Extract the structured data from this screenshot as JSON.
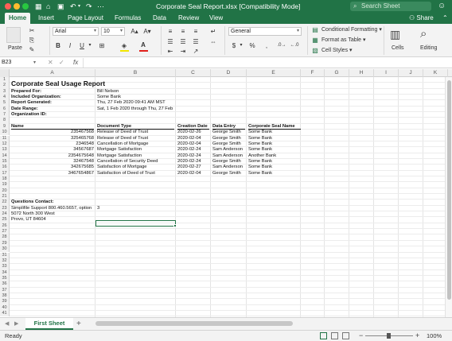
{
  "window": {
    "title": "Corporate Seal Report.xlsx  [Compatibility Mode]",
    "search_placeholder": "Search Sheet",
    "toolbar_icons": [
      "grid-icon",
      "home-icon",
      "save-icon",
      "undo-icon",
      "redo-icon",
      "more-icon"
    ]
  },
  "tabs": [
    "Home",
    "Insert",
    "Page Layout",
    "Formulas",
    "Data",
    "Review",
    "View"
  ],
  "active_tab": "Home",
  "share_label": "Share",
  "ribbon": {
    "paste_label": "Paste",
    "font_name": "Arial",
    "font_size": "10",
    "number_format": "General",
    "bold": "B",
    "italic": "I",
    "underline": "U",
    "grow_font": "A▴",
    "shrink_font": "A▾",
    "currency": "$",
    "percent": "%",
    "comma": ",",
    "conditional_formatting": "Conditional Formatting",
    "format_as_table": "Format as Table",
    "cell_styles": "Cell Styles",
    "cells_label": "Cells",
    "editing_label": "Editing"
  },
  "formula_bar": {
    "name_box": "B23",
    "fx": "fx",
    "cancel": "✕",
    "enter": "✓",
    "content": ""
  },
  "columns": [
    "A",
    "B",
    "C",
    "D",
    "E",
    "F",
    "G",
    "H",
    "I",
    "J",
    "K"
  ],
  "rows": [
    "1",
    "2",
    "3",
    "4",
    "5",
    "6",
    "7",
    "8",
    "9",
    "10",
    "11",
    "12",
    "13",
    "14",
    "15",
    "16",
    "17",
    "18",
    "19",
    "20",
    "21",
    "22",
    "23",
    "24",
    "25",
    "26",
    "27",
    "28",
    "29",
    "30",
    "31",
    "32",
    "33",
    "34",
    "35",
    "36",
    "37",
    "38",
    "39",
    "40",
    "41"
  ],
  "report": {
    "title": "Corporate Seal Usage Report",
    "info": [
      {
        "label": "Prepared For:",
        "value": "Bill Nelson"
      },
      {
        "label": "Included Organization:",
        "value": "Some Bank"
      },
      {
        "label": "Report Generated:",
        "value": "Thu, 27 Feb 2020 09:41 AM MST"
      },
      {
        "label": "Date Range:",
        "value": "Sat, 1 Feb 2020 through Thu, 27 Feb"
      },
      {
        "label": "Organization ID:",
        "value": ""
      }
    ],
    "table_headers": [
      "Name",
      "Document Type",
      "Creation Date",
      "Data Entry",
      "Corporate Seal Name"
    ],
    "table_rows": [
      [
        "235467568",
        "Release of Deed of Trust",
        "2020-02-26",
        "George Smith",
        "Some Bank"
      ],
      [
        "325465768",
        "Release of Deed of Trust",
        "2020-02-04",
        "George Smith",
        "Some Bank"
      ],
      [
        "2346548",
        "Cancellation of Mortgage",
        "2020-02-04",
        "George Smith",
        "Some Bank"
      ],
      [
        "34567687",
        "Mortgage Satisfaction",
        "2020-02-24",
        "Sam Anderson",
        "Some Bank"
      ],
      [
        "2354675648",
        "Mortgage Satisfaction",
        "2020-02-24",
        "Sam Anderson",
        "Another Bank"
      ],
      [
        "32467548",
        "Cancellation of Security Deed",
        "2020-02-24",
        "George Smith",
        "Some Bank"
      ],
      [
        "342675685",
        "Satisfaction of Mortgage",
        "2020-02-27",
        "Sam Anderson",
        "Some Bank"
      ],
      [
        "3467654867",
        "Satisfaction of Deed of Trust",
        "2020-02-04",
        "George Smith",
        "Some Bank"
      ]
    ],
    "contact_label": "Questions Contact:",
    "contact_lines": [
      "Simplifile Support 800.460.5657, option",
      "5072 North 300 West",
      "Provo, UT 84604"
    ],
    "b23_value": "3"
  },
  "sheet_tab": "First Sheet",
  "add_sheet": "+",
  "status": "Ready",
  "zoom": "100%",
  "zoom_minus": "−",
  "zoom_plus": "+",
  "colors": {
    "accent": "#217346",
    "header_bg": "#f0f0f0"
  }
}
